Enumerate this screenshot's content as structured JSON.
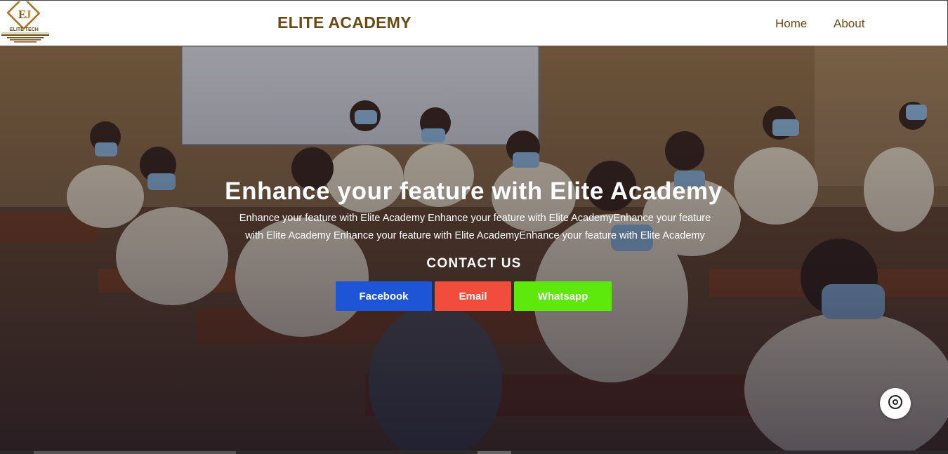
{
  "header": {
    "logo_text": "ELITE TECH",
    "logo_tagline": "Specialist in E-management Website Development",
    "brand": "ELITE ACADEMY",
    "nav": [
      {
        "label": "Home"
      },
      {
        "label": "About"
      }
    ]
  },
  "hero": {
    "title": "Enhance your feature with Elite Academy",
    "subtitle": "Enhance your feature with Elite Academy Enhance your feature with Elite AcademyEnhance your feature with Elite Academy Enhance your feature with Elite AcademyEnhance your feature with Elite Academy",
    "contact_title": "CONTACT US",
    "buttons": [
      {
        "label": "Facebook",
        "color": "#1e55d6"
      },
      {
        "label": "Email",
        "color": "#f24c3d"
      },
      {
        "label": "Whatsapp",
        "color": "#5ee80c"
      }
    ]
  },
  "colors": {
    "brand": "#6b4a12",
    "nav_link": "#6b4a12",
    "logo": "#a87320"
  },
  "icons": {
    "chat": "chat-widget-icon",
    "logo": "elite-tech-logo"
  }
}
